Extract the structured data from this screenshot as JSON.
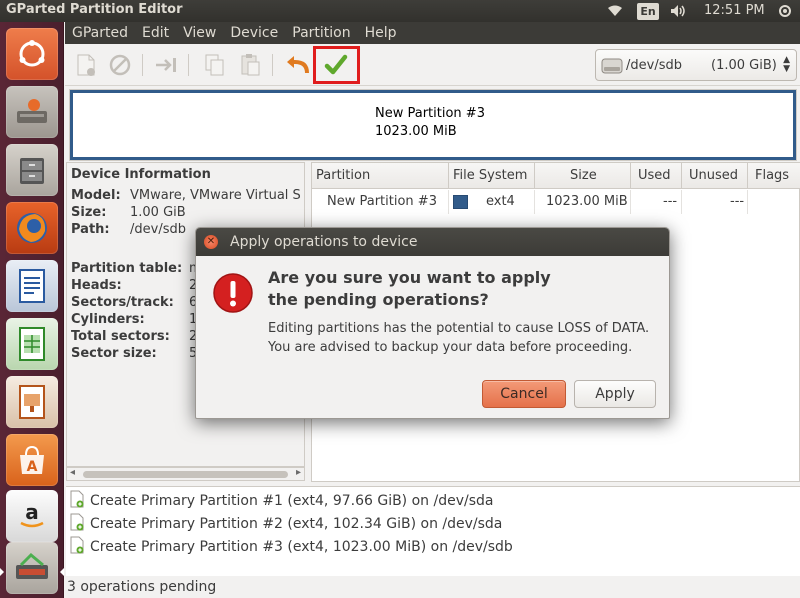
{
  "window": {
    "title": "GParted Partition Editor"
  },
  "indicators": {
    "language": "En",
    "clock": "12:51 PM"
  },
  "menu": [
    "GParted",
    "Edit",
    "View",
    "Device",
    "Partition",
    "Help"
  ],
  "device_selector": {
    "device": "/dev/sdb",
    "size": "(1.00 GiB)"
  },
  "partition_map": {
    "name": "New Partition #3",
    "size": "1023.00 MiB",
    "color": "#315b8a"
  },
  "device_info": {
    "heading": "Device Information",
    "model_label": "Model:",
    "model": "VMware, VMware Virtual S",
    "size_label": "Size:",
    "size": "1.00 GiB",
    "path_label": "Path:",
    "path": "/dev/sdb",
    "partition_table_label": "Partition table:",
    "partition_table": "m",
    "heads_label": "Heads:",
    "heads": "2",
    "sectors_track_label": "Sectors/track:",
    "sectors_track": "6",
    "cylinders_label": "Cylinders:",
    "cylinders": "1",
    "total_sectors_label": "Total sectors:",
    "total_sectors": "2",
    "sector_size_label": "Sector size:",
    "sector_size": "5"
  },
  "partition_table": {
    "columns": [
      "Partition",
      "File System",
      "Size",
      "Used",
      "Unused",
      "Flags"
    ],
    "rows": [
      {
        "partition": "New Partition #3",
        "filesystem": "ext4",
        "size": "1023.00 MiB",
        "used": "---",
        "unused": "---",
        "flags": ""
      }
    ]
  },
  "operations": [
    "Create Primary Partition #1 (ext4, 97.66 GiB) on /dev/sda",
    "Create Primary Partition #2 (ext4, 102.34 GiB) on /dev/sda",
    "Create Primary Partition #3 (ext4, 1023.00 MiB) on /dev/sdb"
  ],
  "status": "3 operations pending",
  "dialog": {
    "title": "Apply operations to device",
    "heading_line1": "Are you sure you want to apply",
    "heading_line2": "the pending operations?",
    "message_line1": "Editing partitions has the potential to cause LOSS of DATA.",
    "message_line2": "You are advised to backup your data before proceeding.",
    "cancel_label": "Cancel",
    "apply_label": "Apply"
  }
}
